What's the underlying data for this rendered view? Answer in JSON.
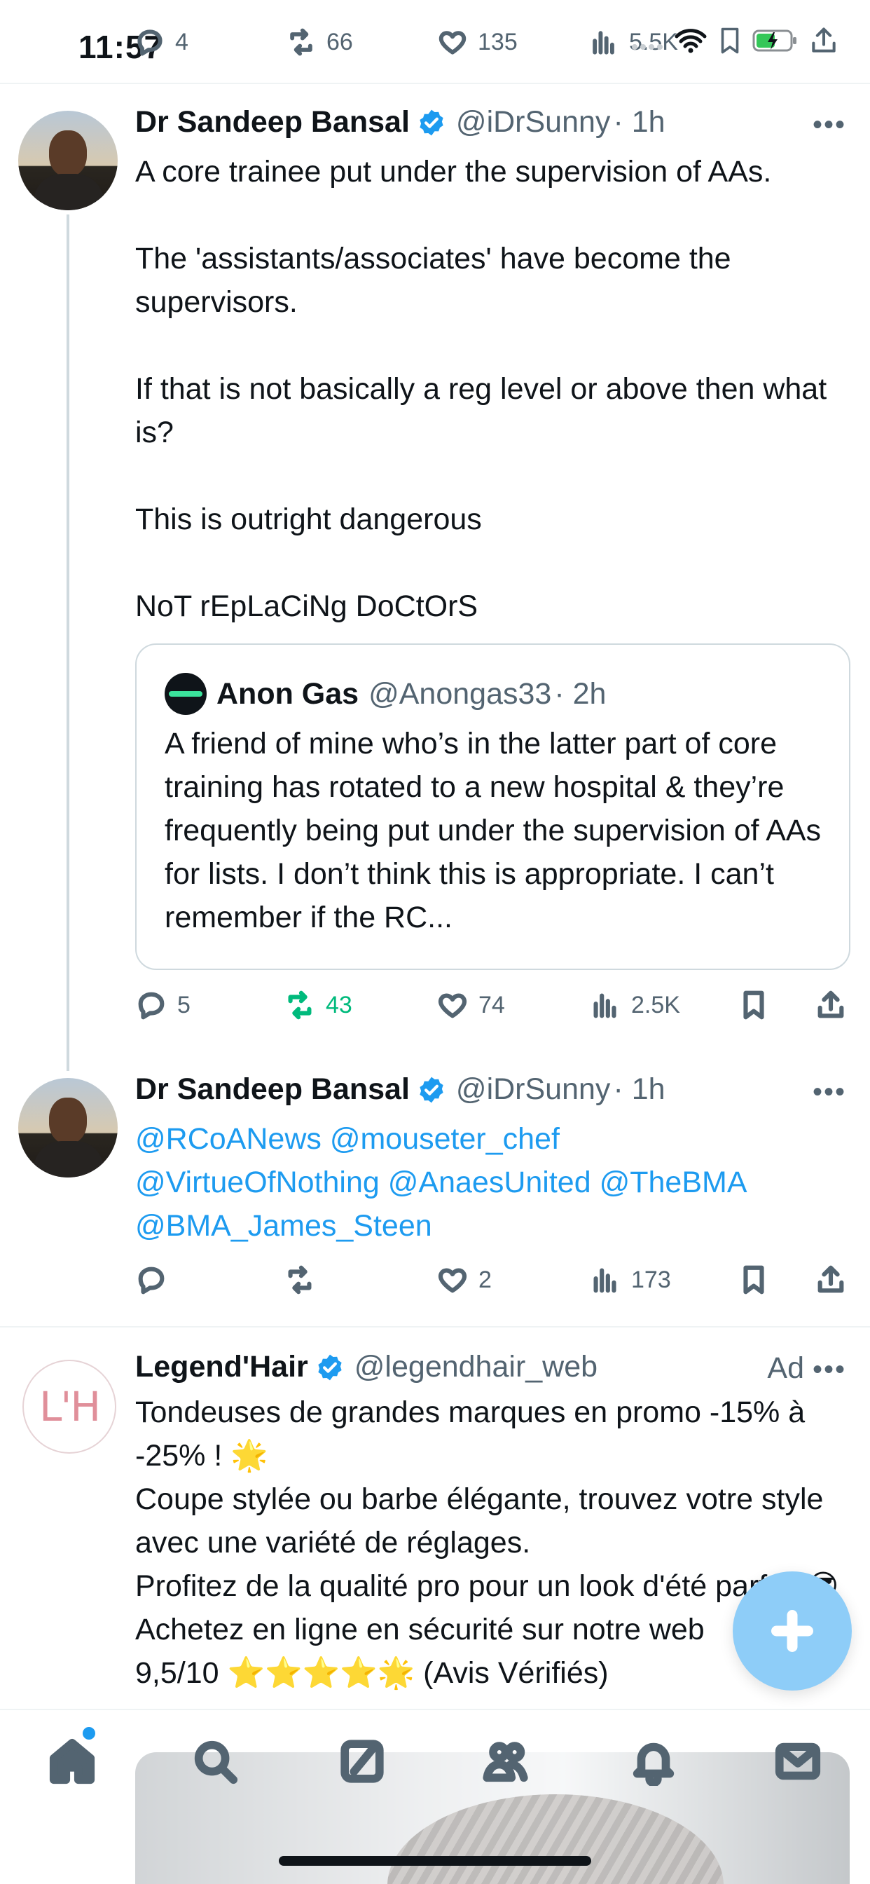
{
  "status_bar": {
    "time": "11:57"
  },
  "top_actions": {
    "replies": "4",
    "reposts": "66",
    "likes": "135",
    "views": "5.5K"
  },
  "tweets": [
    {
      "name": "Dr Sandeep Bansal",
      "handle": "@iDrSunny",
      "time": "· 1h",
      "text": "A core trainee put under the supervision of AAs.\n\nThe 'assistants/associates' have become the supervisors.\n\nIf that is not basically a reg level or above then what is?\n\nThis is outright dangerous\n\nNoT rEpLaCiNg DoCtOrS",
      "quote": {
        "name": "Anon Gas",
        "handle": "@Anongas33",
        "time": "· 2h",
        "text": "A friend of mine who’s in the latter part of core training has rotated to a new hospital & they’re frequently being put under the supervision of AAs for lists. I don’t think this is appropriate. I can’t remember if the RC..."
      },
      "stats": {
        "replies": "5",
        "reposts": "43",
        "likes": "74",
        "views": "2.5K"
      }
    },
    {
      "name": "Dr Sandeep Bansal",
      "handle": "@iDrSunny",
      "time": "· 1h",
      "mentions_line1": "@RCoANews @mouseter_chef",
      "mentions_line2": "@VirtueOfNothing @AnaesUnited @TheBMA",
      "mentions_line3": "@BMA_James_Steen",
      "stats": {
        "replies": "",
        "reposts": "",
        "likes": "2",
        "views": "173"
      }
    },
    {
      "name": "Legend'Hair",
      "handle": "@legendhair_web",
      "ad_label": "Ad",
      "logo_text": "L'H",
      "text": "Tondeuses de grandes marques en promo -15% à -25% ! 🌟\nCoupe stylée ou barbe élégante, trouvez votre style avec une variété de réglages.\nProfitez de la qualité pro pour un look d'été parfait 😎\nAchetez en ligne en sécurité sur notre web\n9,5/10 ⭐⭐⭐⭐🌟 (Avis Vérifiés)"
    }
  ],
  "colors": {
    "accent": "#1d9bf0",
    "repost_active": "#00ba7c",
    "fab": "#8ecdf8"
  }
}
